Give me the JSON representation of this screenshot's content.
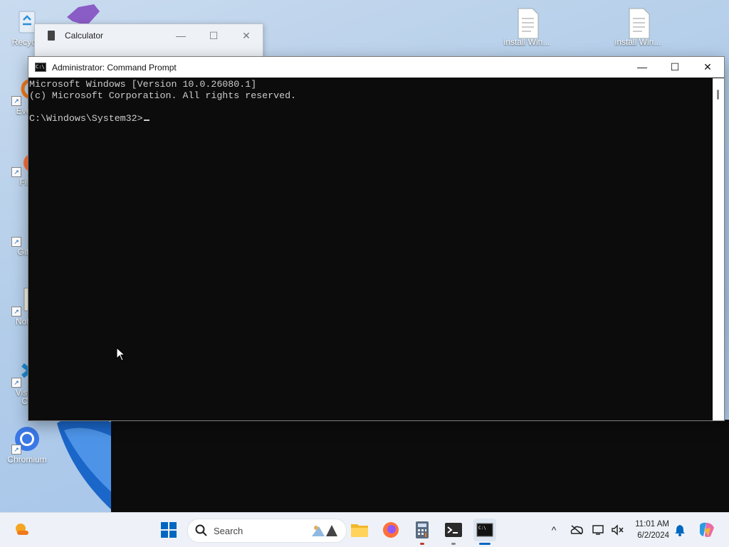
{
  "desktop": {
    "icons": [
      {
        "label": "Recycle"
      },
      {
        "label": "Every"
      },
      {
        "label": "Fire"
      },
      {
        "label": "Git B"
      },
      {
        "label": "Notep"
      },
      {
        "label": "Visual"
      },
      {
        "label": "Co"
      },
      {
        "label": "Chromium"
      },
      {
        "label": "install Win..."
      },
      {
        "label": "install Win..."
      }
    ]
  },
  "calculator": {
    "title": "Calculator",
    "controls": {
      "minimize": "—",
      "maximize": "☐",
      "close": "✕"
    }
  },
  "cmd": {
    "title": "Administrator: Command Prompt",
    "lines": [
      "Microsoft Windows [Version 10.0.26080.1]",
      "(c) Microsoft Corporation. All rights reserved.",
      "",
      "C:\\Windows\\System32>"
    ],
    "controls": {
      "minimize": "—",
      "maximize": "☐",
      "close": "✕"
    }
  },
  "taskbar": {
    "search_placeholder": "Search",
    "clock": {
      "time": "11:01 AM",
      "date": "6/2/2024"
    },
    "colors": {
      "accent": "#0067c0",
      "explorer": "#f2b72a",
      "firefox": "#ff7139"
    }
  }
}
